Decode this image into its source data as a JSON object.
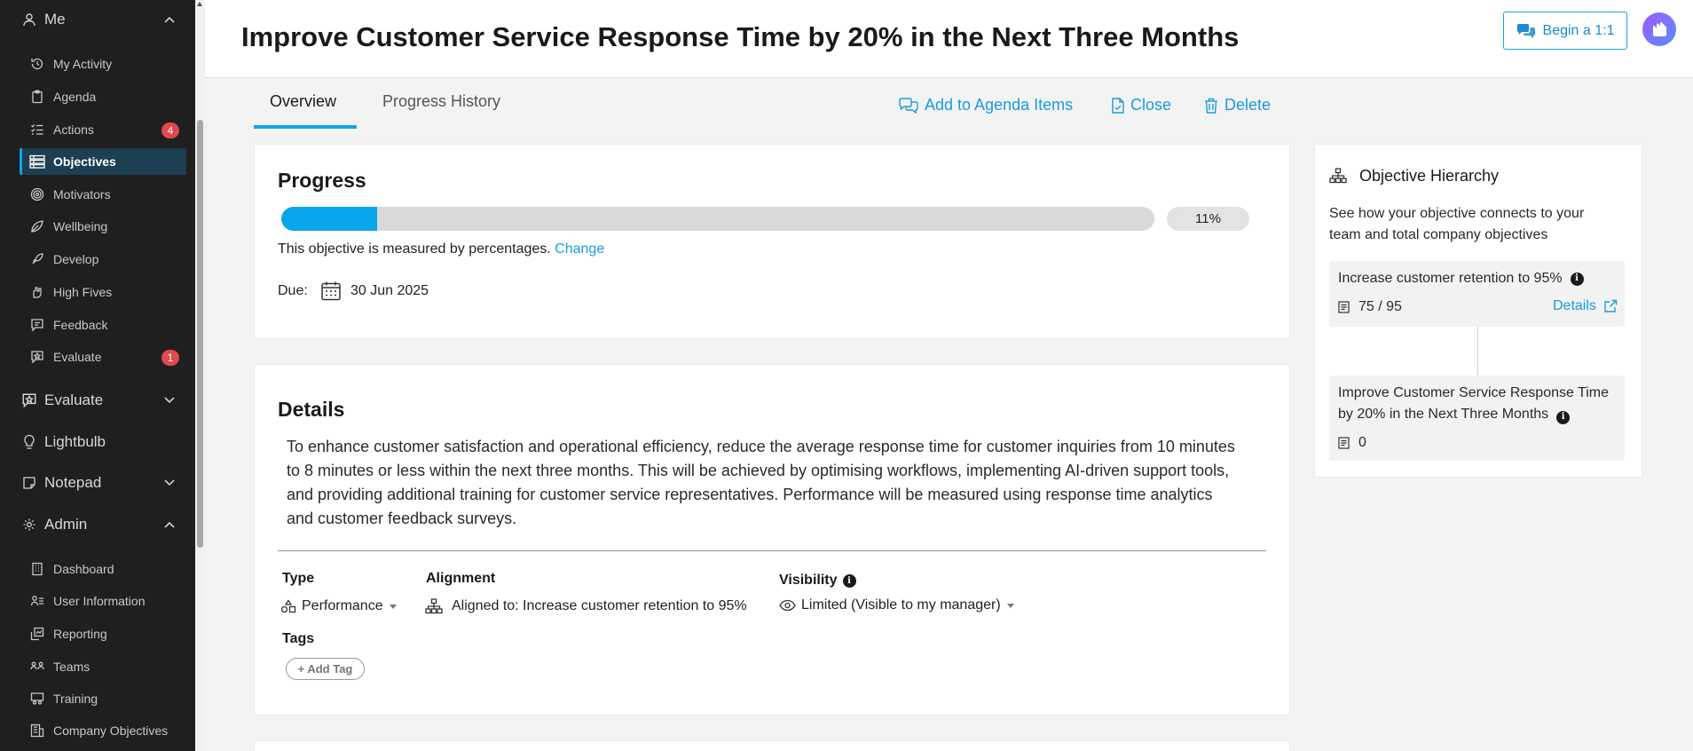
{
  "sidebar": {
    "me_section": "Me",
    "items": [
      {
        "label": "My Activity",
        "icon": "history-icon"
      },
      {
        "label": "Agenda",
        "icon": "clipboard-icon"
      },
      {
        "label": "Actions",
        "icon": "checklist-icon",
        "badge": "4"
      },
      {
        "label": "Objectives",
        "icon": "objectives-icon",
        "active": true
      },
      {
        "label": "Motivators",
        "icon": "target-icon"
      },
      {
        "label": "Wellbeing",
        "icon": "leaf-icon"
      },
      {
        "label": "Develop",
        "icon": "rocket-icon"
      },
      {
        "label": "High Fives",
        "icon": "high-five-icon"
      },
      {
        "label": "Feedback",
        "icon": "feedback-icon"
      },
      {
        "label": "Evaluate",
        "icon": "evaluate-icon",
        "badge": "1"
      }
    ],
    "evaluate_section": "Evaluate",
    "lightbulb_section": "Lightbulb",
    "notepad_section": "Notepad",
    "admin_section": "Admin",
    "admin_items": [
      {
        "label": "Dashboard"
      },
      {
        "label": "User Information"
      },
      {
        "label": "Reporting"
      },
      {
        "label": "Teams"
      },
      {
        "label": "Training"
      },
      {
        "label": "Company Objectives"
      }
    ]
  },
  "header": {
    "title": "Improve Customer Service Response Time by 20% in the Next Three Months",
    "one_on_one_label": "Begin a 1:1"
  },
  "tabs": {
    "overview": "Overview",
    "progress_history": "Progress History"
  },
  "actions": {
    "add_to_agenda": "Add to Agenda Items",
    "close": "Close",
    "delete": "Delete"
  },
  "progress": {
    "title": "Progress",
    "percent_value": 11,
    "percent_label": "11%",
    "measured_text": "This objective is measured by percentages.",
    "change_link": "Change",
    "due_label": "Due:",
    "due_date": "30 Jun 2025"
  },
  "details": {
    "title": "Details",
    "description": "To enhance customer satisfaction and operational efficiency, reduce the average response time for customer inquiries from 10 minutes to 8 minutes or less within the next three months. This will be achieved by optimising workflows, implementing AI-driven support tools, and providing additional training for customer service representatives. Performance will be measured using response time analytics and customer feedback surveys.",
    "type_label": "Type",
    "type_value": "Performance",
    "alignment_label": "Alignment",
    "alignment_value": "Aligned to: Increase customer retention to 95%",
    "visibility_label": "Visibility",
    "visibility_value": "Limited (Visible to my manager)",
    "tags_label": "Tags",
    "add_tag_label": "+ Add Tag"
  },
  "hierarchy": {
    "title": "Objective Hierarchy",
    "description": "See how your objective connects to your team and total company objectives",
    "parent": {
      "title": "Increase customer retention to 95%",
      "value": "75 / 95",
      "details_link": "Details"
    },
    "current": {
      "title": "Improve Customer Service Response Time by 20% in the Next Three Months",
      "value": "0"
    }
  },
  "colors": {
    "accent": "#11a6e8",
    "sidebar_bg": "#1f1f1f",
    "active_item_bg": "#1c3f52",
    "badge": "#e0484d"
  }
}
